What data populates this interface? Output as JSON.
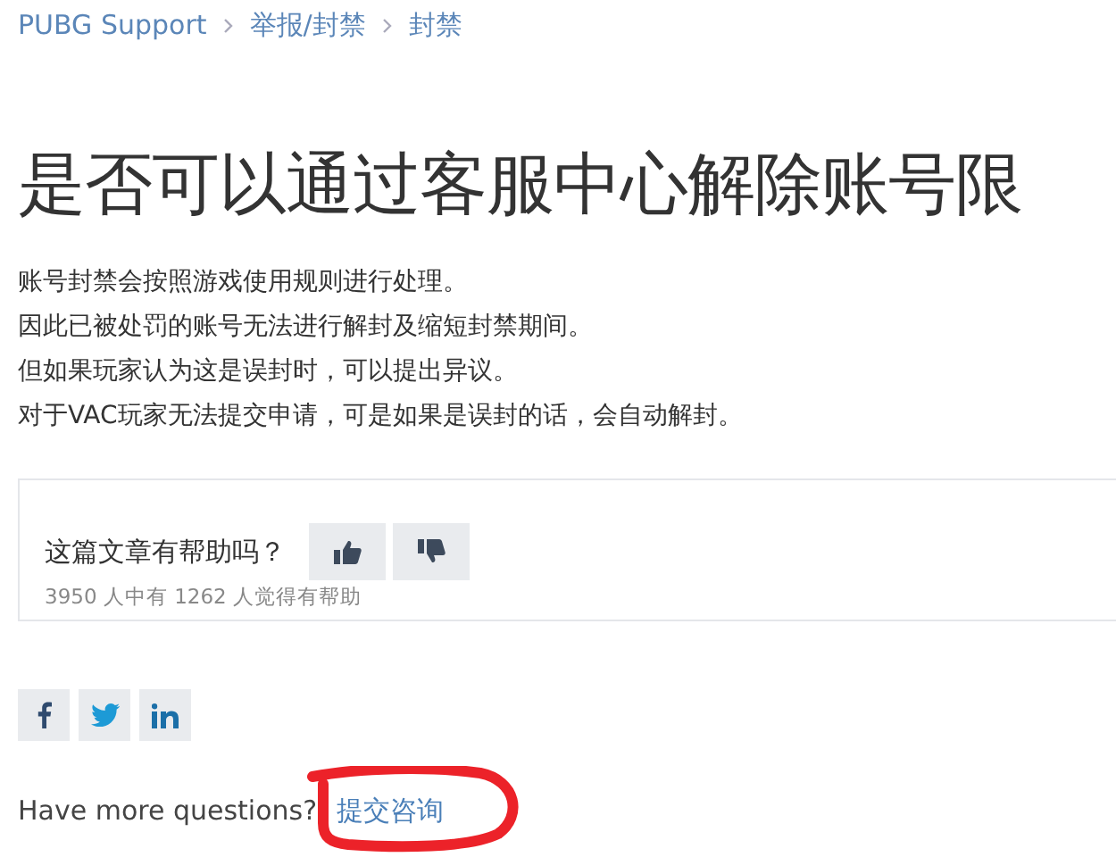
{
  "breadcrumb": [
    {
      "label": "PUBG Support"
    },
    {
      "label": "举报/封禁"
    },
    {
      "label": "封禁"
    }
  ],
  "title": "是否可以通过客服中心解除账号限",
  "body_lines": [
    "账号封禁会按照游戏使用规则进行处理。",
    "因此已被处罚的账号无法进行解封及缩短封禁期间。",
    "但如果玩家认为这是误封时，可以提出异议。",
    "对于VAC玩家无法提交申请，可是如果是误封的话，会自动解封。"
  ],
  "feedback": {
    "question": "这篇文章有帮助吗？",
    "votes": "3950 人中有 1262 人觉得有帮助"
  },
  "share": [
    {
      "kind": "facebook"
    },
    {
      "kind": "twitter"
    },
    {
      "kind": "linkedin"
    }
  ],
  "footer": {
    "prompt": "Have more questions?",
    "link": "提交咨询"
  },
  "annotations": [
    {
      "kind": "freehand-circle"
    }
  ]
}
